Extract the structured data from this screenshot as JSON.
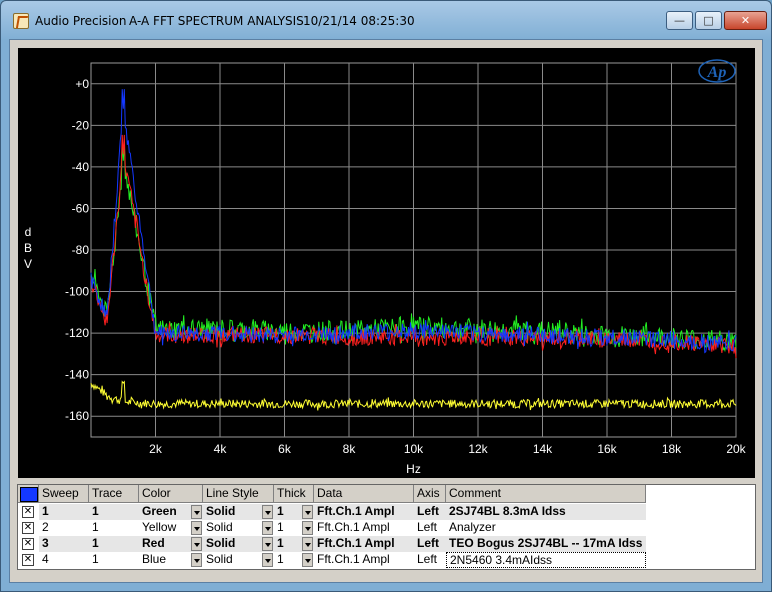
{
  "window": {
    "app_name": "Audio Precision",
    "doc_title": "A-A FFT SPECTRUM ANALYSIS",
    "timestamp": "10/21/14 08:25:30",
    "min_glyph": "—",
    "max_glyph": "□",
    "close_glyph": "✕"
  },
  "logo_text": "Ap",
  "chart_data": {
    "type": "line",
    "xlabel": "Hz",
    "ylabel": "d\nB\nV",
    "xlim": [
      0,
      20000
    ],
    "ylim": [
      -170,
      10
    ],
    "x_ticks": [
      2000,
      4000,
      6000,
      8000,
      10000,
      12000,
      14000,
      16000,
      18000,
      20000
    ],
    "x_tick_labels": [
      "2k",
      "4k",
      "6k",
      "8k",
      "10k",
      "12k",
      "14k",
      "16k",
      "18k",
      "20k"
    ],
    "y_ticks": [
      0,
      -20,
      -40,
      -60,
      -80,
      -100,
      -120,
      -140,
      -160
    ],
    "y_tick_labels": [
      "+0",
      "-20",
      "-40",
      "-60",
      "-80",
      "-100",
      "-120",
      "-140",
      "-160"
    ],
    "grid": true,
    "background": "#000000",
    "fundamental_hz": 1000,
    "series": [
      {
        "name": "2SJ74BL 8.3mA Idss",
        "color": "#22ee22",
        "peak": -37,
        "x": [
          0,
          500,
          1000,
          2000,
          4000,
          6000,
          8000,
          10000,
          12000,
          14000,
          16000,
          18000,
          20000
        ],
        "y": [
          -92,
          -112,
          -37,
          -118,
          -118,
          -119,
          -119,
          -117,
          -118,
          -119,
          -121,
          -122,
          -124
        ]
      },
      {
        "name": "Analyzer",
        "color": "#ffff33",
        "peak": -144,
        "x": [
          0,
          500,
          1000,
          2000,
          4000,
          6000,
          8000,
          10000,
          12000,
          14000,
          16000,
          18000,
          20000
        ],
        "y": [
          -144,
          -150,
          -153,
          -154,
          -154,
          -154,
          -154,
          -154,
          -154,
          -154,
          -154,
          -154,
          -154
        ]
      },
      {
        "name": "TEO Bogus 2SJ74BL -- 17mA Idss",
        "color": "#ff2020",
        "peak": -34,
        "x": [
          0,
          500,
          1000,
          2000,
          4000,
          6000,
          8000,
          10000,
          12000,
          14000,
          16000,
          18000,
          20000
        ],
        "y": [
          -95,
          -115,
          -34,
          -121,
          -121,
          -121,
          -122,
          -122,
          -122,
          -123,
          -123,
          -124,
          -126
        ]
      },
      {
        "name": "2N5460 3.4mAIdss",
        "color": "#1438ff",
        "peak": -12,
        "x": [
          0,
          500,
          1000,
          2000,
          4000,
          6000,
          8000,
          10000,
          12000,
          14000,
          16000,
          18000,
          20000
        ],
        "y": [
          -94,
          -113,
          -12,
          -120,
          -120,
          -121,
          -120,
          -119,
          -120,
          -121,
          -122,
          -123,
          -125
        ]
      }
    ]
  },
  "table": {
    "headers": {
      "sweep": "Sweep",
      "trace": "Trace",
      "color": "Color",
      "line_style": "Line Style",
      "thick": "Thick",
      "data": "Data",
      "axis": "Axis",
      "comment": "Comment"
    },
    "rows": [
      {
        "check": "✕",
        "sweep": "1",
        "trace": "1",
        "color": "Green",
        "line_style": "Solid",
        "thick": "1",
        "data": "Fft.Ch.1 Ampl",
        "axis": "Left",
        "comment": "2SJ74BL 8.3mA Idss",
        "bold": true
      },
      {
        "check": "✕",
        "sweep": "2",
        "trace": "1",
        "color": "Yellow",
        "line_style": "Solid",
        "thick": "1",
        "data": "Fft.Ch.1 Ampl",
        "axis": "Left",
        "comment": "Analyzer",
        "bold": false
      },
      {
        "check": "✕",
        "sweep": "3",
        "trace": "1",
        "color": "Red",
        "line_style": "Solid",
        "thick": "1",
        "data": "Fft.Ch.1 Ampl",
        "axis": "Left",
        "comment": "TEO Bogus 2SJ74BL -- 17mA Idss",
        "bold": true
      },
      {
        "check": "✕",
        "sweep": "4",
        "trace": "1",
        "color": "Blue",
        "line_style": "Solid",
        "thick": "1",
        "data": "Fft.Ch.1 Ampl",
        "axis": "Left",
        "comment": "2N5460  3.4mAIdss",
        "bold": false
      }
    ]
  }
}
